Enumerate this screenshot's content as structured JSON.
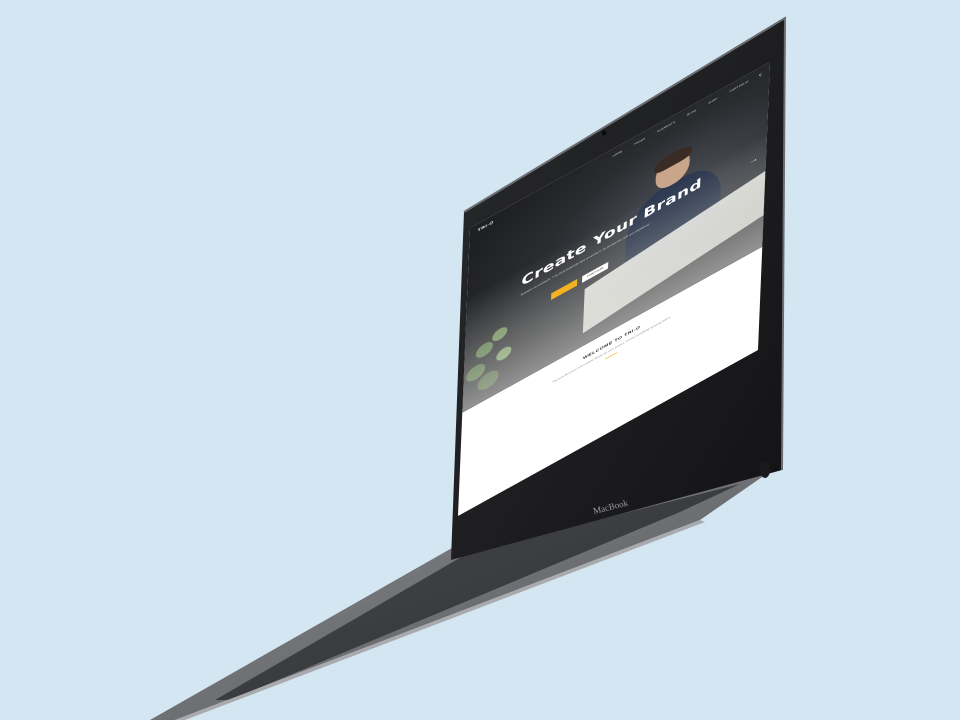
{
  "site": {
    "logo": "TRI-O",
    "nav": [
      "HOME",
      "PAGES",
      "ELEMENTS",
      "BLOG",
      "SHOP",
      "PORTFOLIO"
    ],
    "hero": {
      "title": "Create Your Brand",
      "text": "Brandon Commitsoft: \"The best business and creativity to be productive and accomplished.\"",
      "primary_button": "",
      "secondary_button": "PURCHASE"
    },
    "welcome": {
      "title": "WELCOME TO TRI-O",
      "text": "The best business and creative theme for your project. Create something amazing with it."
    }
  },
  "device": {
    "brand": "MacBook"
  },
  "colors": {
    "background": "#d3e6f2",
    "accent": "#f3b321",
    "hero_dark": "#222326",
    "laptop_body": "#5e6064"
  }
}
